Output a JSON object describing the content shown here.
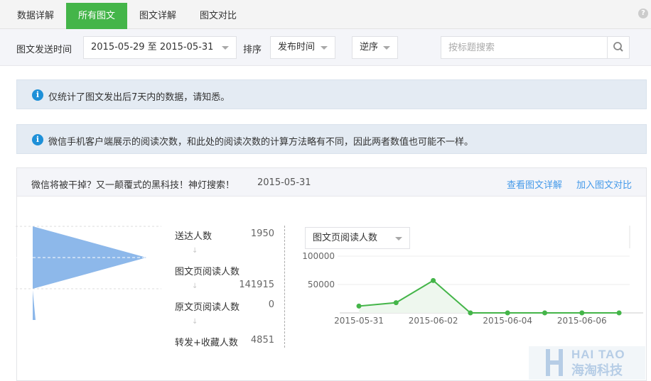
{
  "tabs": [
    "数据详解",
    "所有图文",
    "图文详解",
    "图文对比"
  ],
  "help_icon": "?",
  "filter": {
    "send_time_label": "图文发送时间",
    "date_range": "2015-05-29 至 2015-05-31",
    "sort_label": "排序",
    "sort_by": "发布时间",
    "order": "逆序",
    "search_placeholder": "按标题搜索"
  },
  "notices": [
    "仅统计了图文发出后7天内的数据，请知悉。",
    "微信手机客户端展示的阅读次数，和此处的阅读次数的计算方法略有不同，因此两者数值也可能不一样。"
  ],
  "article": {
    "title": "微信将被干掉？又一颠覆式的黑科技！神灯搜索！",
    "date": "2015-05-31",
    "detail_link": "查看图文详解",
    "compare_link": "加入图文对比",
    "funnel": [
      {
        "label": "送达人数",
        "value": "1950"
      },
      {
        "label": "图文页阅读人数",
        "value": "141915"
      },
      {
        "label": "原文页阅读人数",
        "value": "0"
      },
      {
        "label": "转发+收藏人数",
        "value": "4851"
      }
    ],
    "metric_select": "图文页阅读人数"
  },
  "chart_data": {
    "type": "line",
    "x": [
      "2015-05-31",
      "2015-06-01",
      "2015-06-02",
      "2015-06-03",
      "2015-06-04",
      "2015-06-05",
      "2015-06-06",
      "2015-06-07"
    ],
    "xtick_labels": [
      "2015-05-31",
      "2015-06-02",
      "2015-06-04",
      "2015-06-06"
    ],
    "series": [
      {
        "values": [
          12000,
          18000,
          57000,
          0,
          0,
          0,
          0,
          0
        ]
      }
    ],
    "yticks": [
      "100000",
      "50000"
    ],
    "ylim": [
      0,
      100000
    ],
    "color": "#44b549"
  },
  "watermark": {
    "top": "HAI TAO",
    "bottom": "海淘科技"
  },
  "colors": {
    "accent": "#44b549",
    "link": "#459ae9",
    "funnel": "#8db8ea",
    "info": "#1e90d8"
  }
}
